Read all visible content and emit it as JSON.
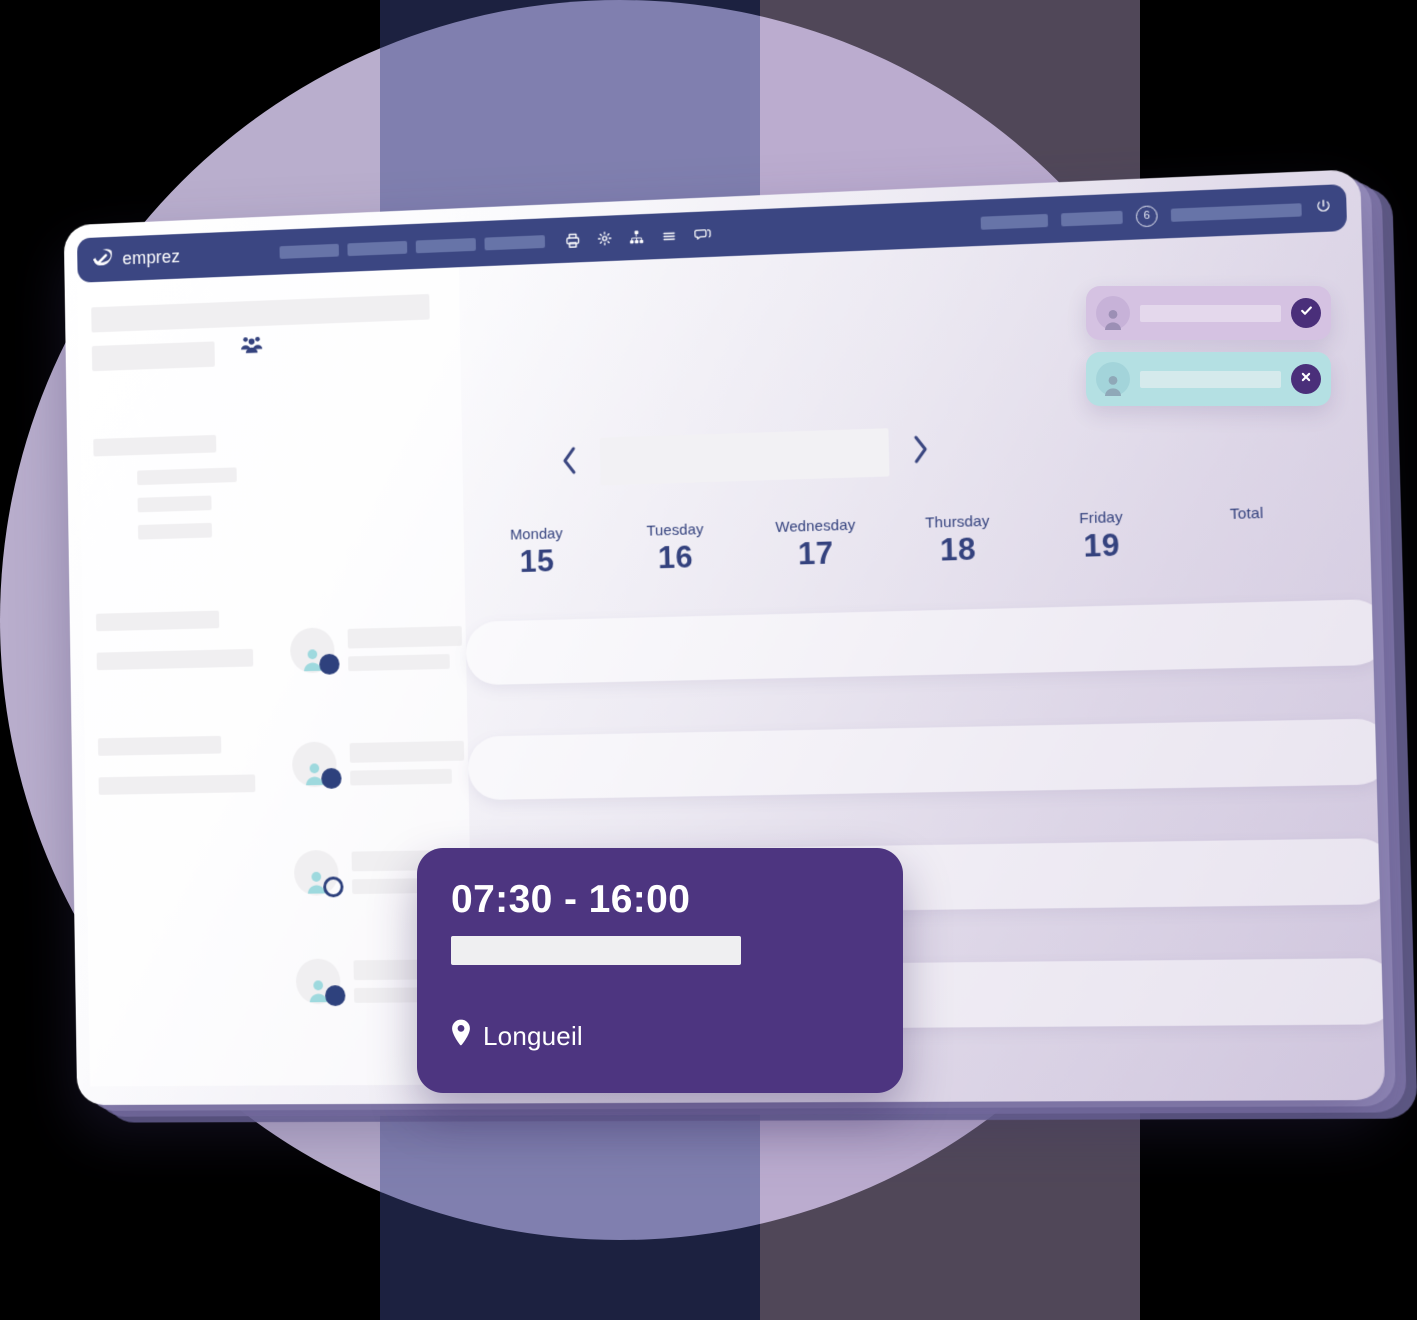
{
  "brand": {
    "name": "emprez",
    "logo_icon": "emprez-check-swoosh-logo"
  },
  "topnav": {
    "menu_items": [
      "",
      "",
      "",
      ""
    ],
    "icons": [
      {
        "name": "printer-icon"
      },
      {
        "name": "gear-icon"
      },
      {
        "name": "org-chart-icon"
      },
      {
        "name": "hamburger-menu-icon"
      },
      {
        "name": "chat-bubbles-icon"
      }
    ],
    "right_chips": [
      "",
      "",
      ""
    ],
    "notification_count": "6",
    "power_icon": "power-icon"
  },
  "sidebar": {
    "group_icon": "users-group-icon",
    "skeleton_rows": [
      "",
      "",
      "",
      "",
      "",
      "",
      "",
      "",
      "",
      ""
    ]
  },
  "week_nav": {
    "prev_icon": "chevron-left-icon",
    "next_icon": "chevron-right-icon",
    "week_label": ""
  },
  "schedule": {
    "columns": [
      {
        "day_name": "Monday",
        "day_number": "15"
      },
      {
        "day_name": "Tuesday",
        "day_number": "16"
      },
      {
        "day_name": "Wednesday",
        "day_number": "17"
      },
      {
        "day_name": "Thursday",
        "day_number": "18"
      },
      {
        "day_name": "Friday",
        "day_number": "19"
      }
    ],
    "total_label": "Total",
    "employees": [
      {
        "name": "",
        "role": "",
        "status": "filled"
      },
      {
        "name": "",
        "role": "",
        "status": "filled"
      },
      {
        "name": "",
        "role": "",
        "status": "hollow"
      },
      {
        "name": "",
        "role": "",
        "status": "filled"
      }
    ],
    "rows": [
      "",
      "",
      "",
      ""
    ]
  },
  "notifications": [
    {
      "type": "approve",
      "avatar_icon": "person-avatar-icon",
      "label": "",
      "action_icon": "check-icon",
      "bg": "#d5c2e2",
      "action_bg": "#4a2f7a"
    },
    {
      "type": "reject",
      "avatar_icon": "person-avatar-icon",
      "label": "",
      "action_icon": "close-x-icon",
      "bg": "#b4e0e3",
      "action_bg": "#4a2f7a"
    }
  ],
  "shift_card": {
    "time_range": "07:30 - 16:00",
    "title": "",
    "location_icon": "map-pin-icon",
    "location": "Longueil",
    "bg": "#4d3580"
  },
  "colors": {
    "nav_blue": "#3b4682",
    "text_blue": "#34427e",
    "card_purple": "#4d3580",
    "badge_purple": "#4a2f7a",
    "approve_bg": "#d5c2e2",
    "reject_bg": "#b4e0e3",
    "avatar_teal": "#9ed9de",
    "bg_circle": "#b9aecd"
  }
}
